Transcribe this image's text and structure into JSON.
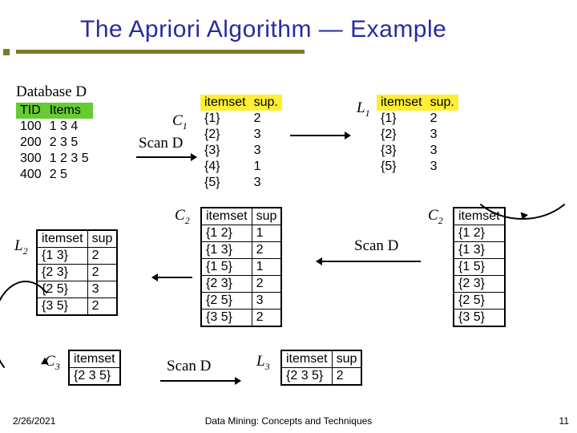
{
  "title": "The Apriori Algorithm — Example",
  "footer": {
    "date": "2/26/2021",
    "center": "Data Mining: Concepts and Techniques",
    "page": "11"
  },
  "labels": {
    "databaseD": "Database D",
    "C1": "C",
    "C1s": "1",
    "L1": "L",
    "L1s": "1",
    "C2a": "C",
    "C2as": "2",
    "C2b": "C",
    "C2bs": "2",
    "L2": "L",
    "L2s": "2",
    "C3": "C",
    "C3s": "3",
    "L3": "L",
    "L3s": "3",
    "scanD": "Scan D"
  },
  "databaseD": {
    "headers": [
      "TID",
      "Items"
    ],
    "rows": [
      [
        "100",
        "1 3 4"
      ],
      [
        "200",
        "2 3 5"
      ],
      [
        "300",
        "1 2 3 5"
      ],
      [
        "400",
        "2 5"
      ]
    ]
  },
  "C1": {
    "headers": [
      "itemset",
      "sup."
    ],
    "rows": [
      [
        "{1}",
        "2"
      ],
      [
        "{2}",
        "3"
      ],
      [
        "{3}",
        "3"
      ],
      [
        "{4}",
        "1"
      ],
      [
        "{5}",
        "3"
      ]
    ]
  },
  "L1": {
    "headers": [
      "itemset",
      "sup."
    ],
    "rows": [
      [
        "{1}",
        "2"
      ],
      [
        "{2}",
        "3"
      ],
      [
        "{3}",
        "3"
      ],
      [
        "{5}",
        "3"
      ]
    ]
  },
  "C2_items": {
    "headers": [
      "itemset"
    ],
    "rows": [
      [
        "{1 2}"
      ],
      [
        "{1 3}"
      ],
      [
        "{1 5}"
      ],
      [
        "{2 3}"
      ],
      [
        "{2 5}"
      ],
      [
        "{3 5}"
      ]
    ]
  },
  "C2_sup": {
    "headers": [
      "itemset",
      "sup"
    ],
    "rows": [
      [
        "{1 2}",
        "1"
      ],
      [
        "{1 3}",
        "2"
      ],
      [
        "{1 5}",
        "1"
      ],
      [
        "{2 3}",
        "2"
      ],
      [
        "{2 5}",
        "3"
      ],
      [
        "{3 5}",
        "2"
      ]
    ]
  },
  "L2": {
    "headers": [
      "itemset",
      "sup"
    ],
    "rows": [
      [
        "{1 3}",
        "2"
      ],
      [
        "{2 3}",
        "2"
      ],
      [
        "{2 5}",
        "3"
      ],
      [
        "{3 5}",
        "2"
      ]
    ]
  },
  "C3": {
    "headers": [
      "itemset"
    ],
    "rows": [
      [
        "{2 3 5}"
      ]
    ]
  },
  "L3": {
    "headers": [
      "itemset",
      "sup"
    ],
    "rows": [
      [
        "{2 3 5}",
        "2"
      ]
    ]
  }
}
